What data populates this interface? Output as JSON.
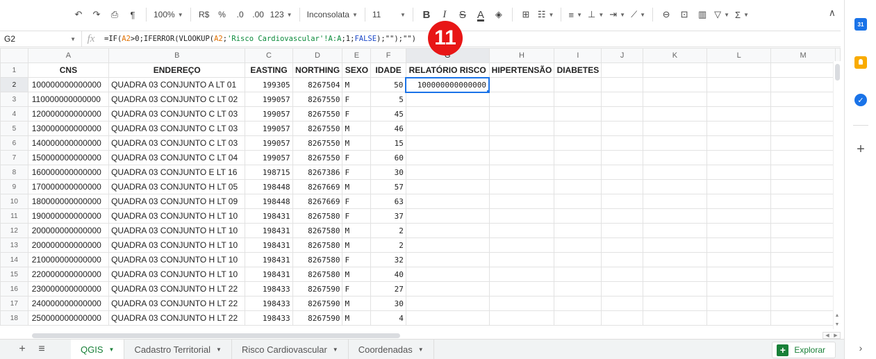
{
  "toolbar": {
    "undo_icon": "undo-icon",
    "redo_icon": "redo-icon",
    "print_icon": "print-icon",
    "paint_format_icon": "paint-format-icon",
    "zoom": "100%",
    "currency": "R$",
    "percent": "%",
    "decrease_decimal": ".0",
    "increase_decimal": ".00",
    "more_formats": "123",
    "font_name": "Inconsolata",
    "font_size": "11",
    "bold": "B",
    "italic": "I",
    "strikethrough": "S",
    "text_color": "A"
  },
  "formula_bar": {
    "cell_ref": "G2",
    "fx": "fx",
    "formula_parts": {
      "p1": "=IF(",
      "r1": "A2",
      "p2": ">0;",
      "kw1": "IFERROR",
      "p3": "(",
      "kw2": "VLOOKUP",
      "p4": "(",
      "r2": "A2",
      "p5": ";",
      "r3": "'Risco Cardiovascular'!A:A",
      "p6": ";1;",
      "kw3": "FALSE",
      "p7": ");\"\");\"\")"
    }
  },
  "badge": "11",
  "columns": [
    "A",
    "B",
    "C",
    "D",
    "E",
    "F",
    "G",
    "H",
    "I",
    "J",
    "K",
    "L",
    "M"
  ],
  "header_row": {
    "num": "1",
    "cells": [
      "CNS",
      "ENDEREÇO",
      "EASTING",
      "NORTHING",
      "SEXO",
      "IDADE",
      "RELATÓRIO RISCO",
      "HIPERTENSÃO",
      "DIABETES",
      "",
      "",
      "",
      ""
    ]
  },
  "rows": [
    {
      "num": "2",
      "cns": "100000000000000",
      "endereco": "QUADRA 03 CONJUNTO A LT 01",
      "easting": "199305",
      "northing": "8267504",
      "sexo": "M",
      "idade": "50",
      "relatorio": "100000000000000"
    },
    {
      "num": "3",
      "cns": "110000000000000",
      "endereco": "QUADRA 03 CONJUNTO C LT 02",
      "easting": "199057",
      "northing": "8267550",
      "sexo": "F",
      "idade": "5",
      "relatorio": ""
    },
    {
      "num": "4",
      "cns": "120000000000000",
      "endereco": "QUADRA 03 CONJUNTO C LT 03",
      "easting": "199057",
      "northing": "8267550",
      "sexo": "F",
      "idade": "45",
      "relatorio": ""
    },
    {
      "num": "5",
      "cns": "130000000000000",
      "endereco": "QUADRA 03 CONJUNTO C LT 03",
      "easting": "199057",
      "northing": "8267550",
      "sexo": "M",
      "idade": "46",
      "relatorio": ""
    },
    {
      "num": "6",
      "cns": "140000000000000",
      "endereco": "QUADRA 03 CONJUNTO C LT 03",
      "easting": "199057",
      "northing": "8267550",
      "sexo": "M",
      "idade": "15",
      "relatorio": ""
    },
    {
      "num": "7",
      "cns": "150000000000000",
      "endereco": "QUADRA 03 CONJUNTO C LT 04",
      "easting": "199057",
      "northing": "8267550",
      "sexo": "F",
      "idade": "60",
      "relatorio": ""
    },
    {
      "num": "8",
      "cns": "160000000000000",
      "endereco": "QUADRA 03 CONJUNTO E LT 16",
      "easting": "198715",
      "northing": "8267386",
      "sexo": "F",
      "idade": "30",
      "relatorio": ""
    },
    {
      "num": "9",
      "cns": "170000000000000",
      "endereco": "QUADRA 03 CONJUNTO H LT 05",
      "easting": "198448",
      "northing": "8267669",
      "sexo": "M",
      "idade": "57",
      "relatorio": ""
    },
    {
      "num": "10",
      "cns": "180000000000000",
      "endereco": "QUADRA 03 CONJUNTO H LT 09",
      "easting": "198448",
      "northing": "8267669",
      "sexo": "F",
      "idade": "63",
      "relatorio": ""
    },
    {
      "num": "11",
      "cns": "190000000000000",
      "endereco": "QUADRA 03 CONJUNTO H LT 10",
      "easting": "198431",
      "northing": "8267580",
      "sexo": "F",
      "idade": "37",
      "relatorio": ""
    },
    {
      "num": "12",
      "cns": "200000000000000",
      "endereco": "QUADRA 03 CONJUNTO H LT 10",
      "easting": "198431",
      "northing": "8267580",
      "sexo": "M",
      "idade": "2",
      "relatorio": ""
    },
    {
      "num": "13",
      "cns": "200000000000000",
      "endereco": "QUADRA 03 CONJUNTO H LT 10",
      "easting": "198431",
      "northing": "8267580",
      "sexo": "M",
      "idade": "2",
      "relatorio": ""
    },
    {
      "num": "14",
      "cns": "210000000000000",
      "endereco": "QUADRA 03 CONJUNTO H LT 10",
      "easting": "198431",
      "northing": "8267580",
      "sexo": "F",
      "idade": "32",
      "relatorio": ""
    },
    {
      "num": "15",
      "cns": "220000000000000",
      "endereco": "QUADRA 03 CONJUNTO H LT 10",
      "easting": "198431",
      "northing": "8267580",
      "sexo": "M",
      "idade": "40",
      "relatorio": ""
    },
    {
      "num": "16",
      "cns": "230000000000000",
      "endereco": "QUADRA 03 CONJUNTO H LT 22",
      "easting": "198433",
      "northing": "8267590",
      "sexo": "F",
      "idade": "27",
      "relatorio": ""
    },
    {
      "num": "17",
      "cns": "240000000000000",
      "endereco": "QUADRA 03 CONJUNTO H LT 22",
      "easting": "198433",
      "northing": "8267590",
      "sexo": "M",
      "idade": "30",
      "relatorio": ""
    },
    {
      "num": "18",
      "cns": "250000000000000",
      "endereco": "QUADRA 03 CONJUNTO H LT 22",
      "easting": "198433",
      "northing": "8267590",
      "sexo": "M",
      "idade": "4",
      "relatorio": ""
    }
  ],
  "sheet_tabs": [
    {
      "label": "QGIS",
      "active": true
    },
    {
      "label": "Cadastro Territorial",
      "active": false
    },
    {
      "label": "Risco Cardiovascular",
      "active": false
    },
    {
      "label": "Coordenadas",
      "active": false
    }
  ],
  "explore_label": "Explorar",
  "colors": {
    "accent": "#1a73e8",
    "active_tab": "#188038",
    "badge": "#e81616"
  }
}
